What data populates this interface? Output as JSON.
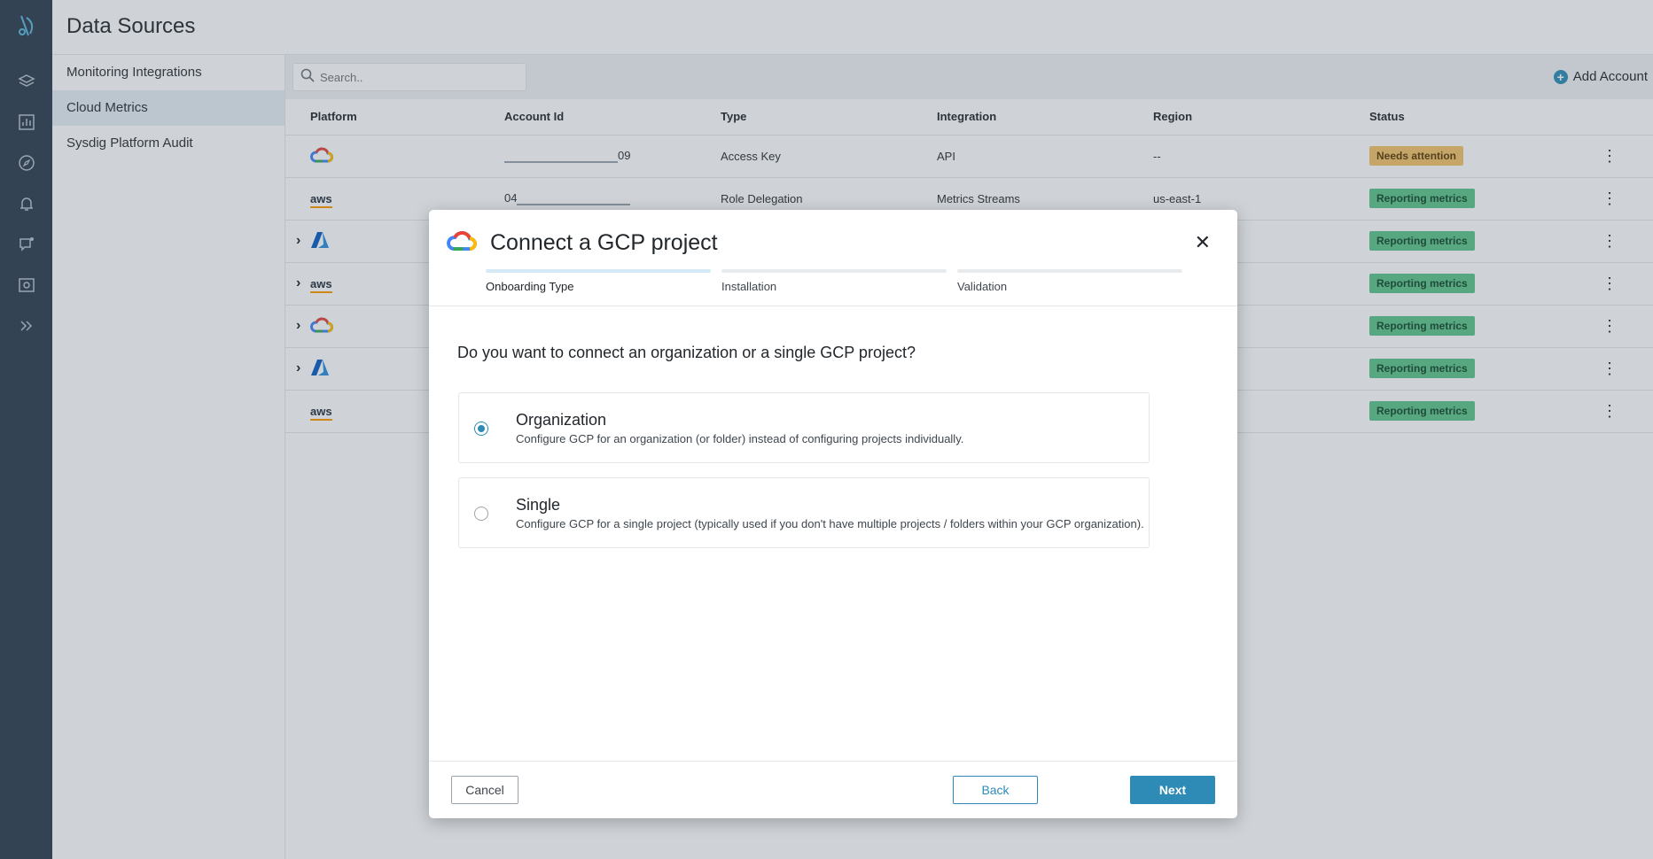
{
  "header": {
    "title": "Data Sources"
  },
  "sidebar": {
    "items": [
      {
        "label": "Monitoring Integrations"
      },
      {
        "label": "Cloud Metrics"
      },
      {
        "label": "Sysdig Platform Audit"
      }
    ]
  },
  "toolbar": {
    "search_placeholder": "Search..",
    "add_account_label": "Add Account"
  },
  "table": {
    "headers": [
      "Platform",
      "Account Id",
      "Type",
      "Integration",
      "Region",
      "Status"
    ],
    "rows": [
      {
        "platform": "gcp",
        "account_id_suffix": "09",
        "type": "Access Key",
        "integration": "API",
        "region": "--",
        "status": "Needs attention"
      },
      {
        "platform": "aws",
        "account_id_prefix": "04",
        "type": "Role Delegation",
        "integration": "Metrics Streams",
        "region": "us-east-1",
        "status": "Reporting metrics"
      },
      {
        "platform": "azure",
        "status": "Reporting metrics"
      },
      {
        "platform": "aws",
        "status": "Reporting metrics"
      },
      {
        "platform": "gcp",
        "status": "Reporting metrics"
      },
      {
        "platform": "azure",
        "status": "Reporting metrics"
      },
      {
        "platform": "aws",
        "status": "Reporting metrics"
      }
    ]
  },
  "modal": {
    "title": "Connect a GCP project",
    "steps": [
      {
        "label": "Onboarding Type"
      },
      {
        "label": "Installation"
      },
      {
        "label": "Validation"
      }
    ],
    "question": "Do you want to connect an organization or a single GCP project?",
    "options": [
      {
        "title": "Organization",
        "desc": "Configure GCP for an organization (or folder) instead of configuring projects individually.",
        "selected": true
      },
      {
        "title": "Single",
        "desc": "Configure GCP for a single project (typically used if you don't have multiple projects / folders within your GCP organization).",
        "selected": false
      }
    ],
    "cancel_label": "Cancel",
    "back_label": "Back",
    "next_label": "Next"
  },
  "colors": {
    "accent": "#2d8bb5",
    "nav_bg": "#2e3d4d",
    "reporting": "#5ec48a",
    "attention": "#f3c26a"
  }
}
